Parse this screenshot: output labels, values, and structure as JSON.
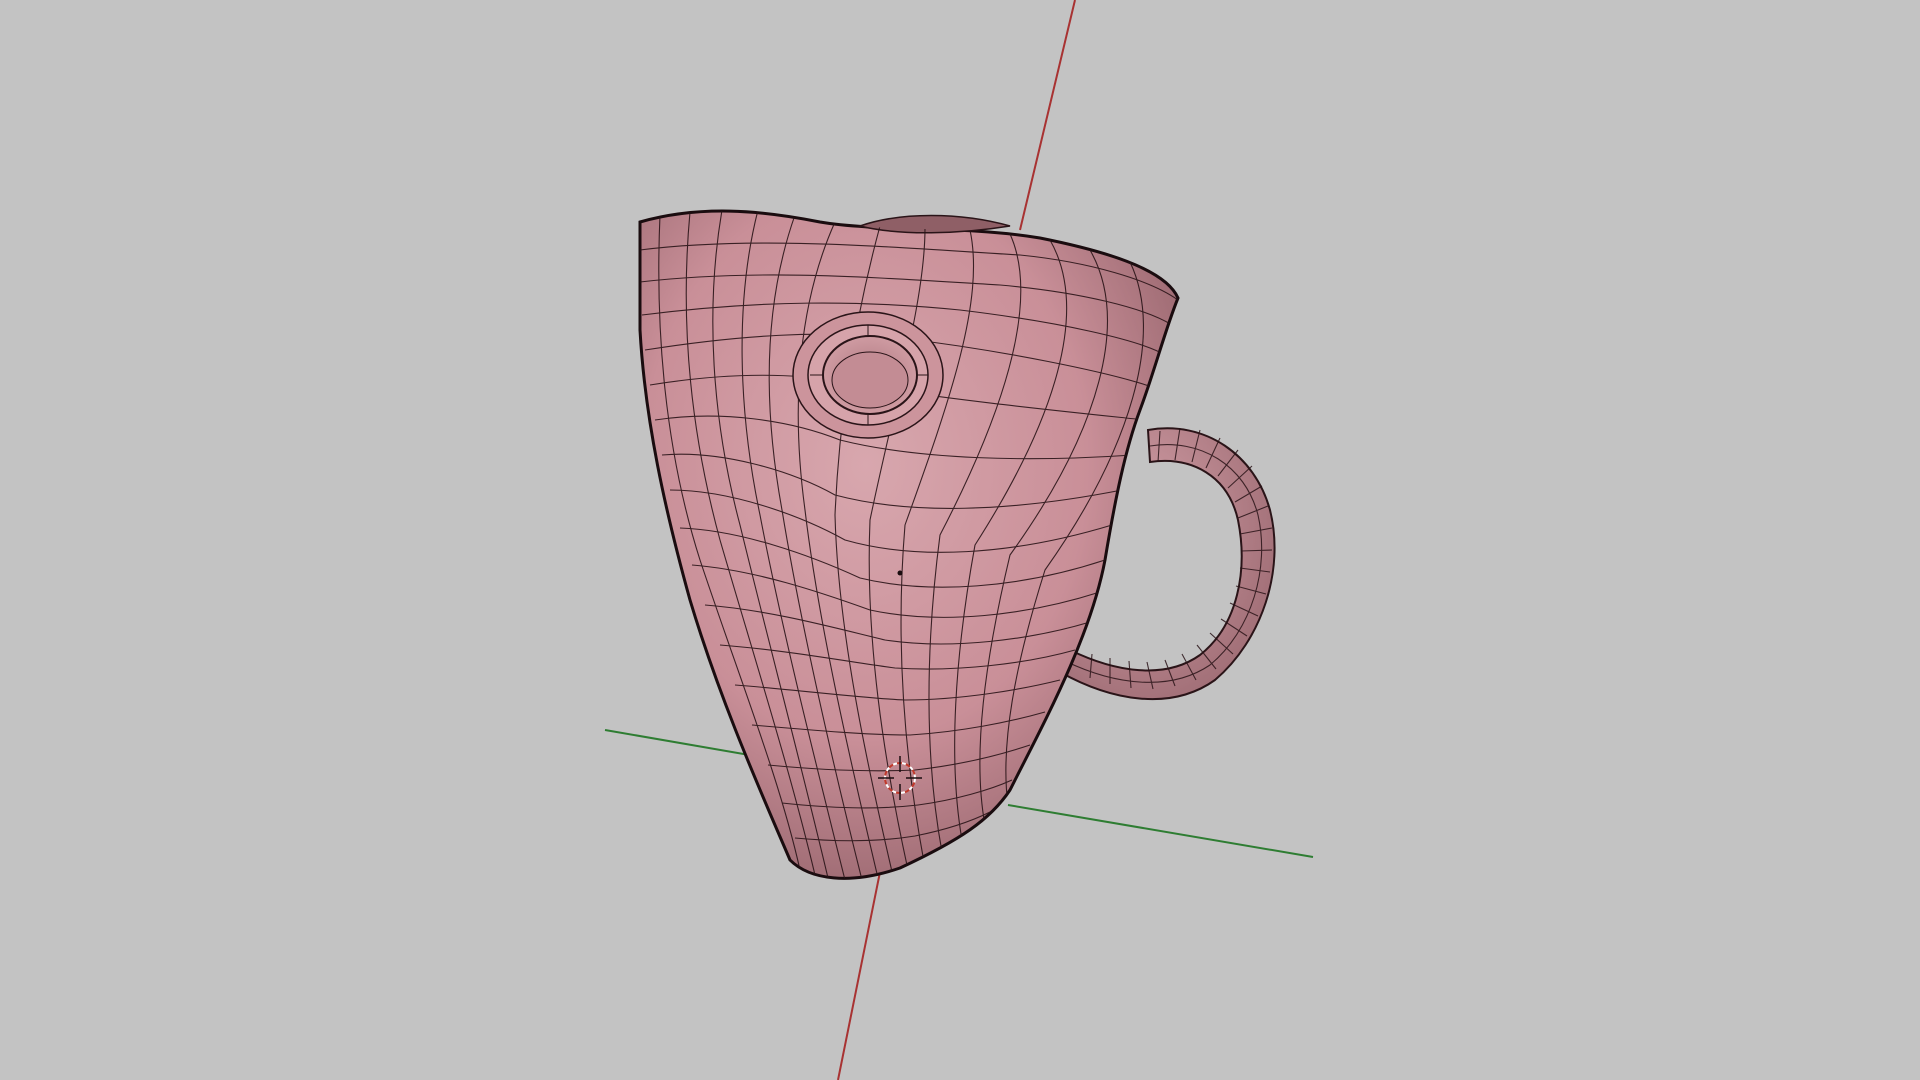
{
  "viewport": {
    "background": "#c3c3c3",
    "axis_colors": {
      "x_axis": "#2e7d32",
      "z_axis": "#a83232"
    },
    "model": {
      "object": "mug",
      "surface_color": "#c98f98",
      "wire_color": "#2a1418",
      "display_mode": "shaded-with-wireframe"
    },
    "pivot_icon": "3d-cursor-icon"
  }
}
